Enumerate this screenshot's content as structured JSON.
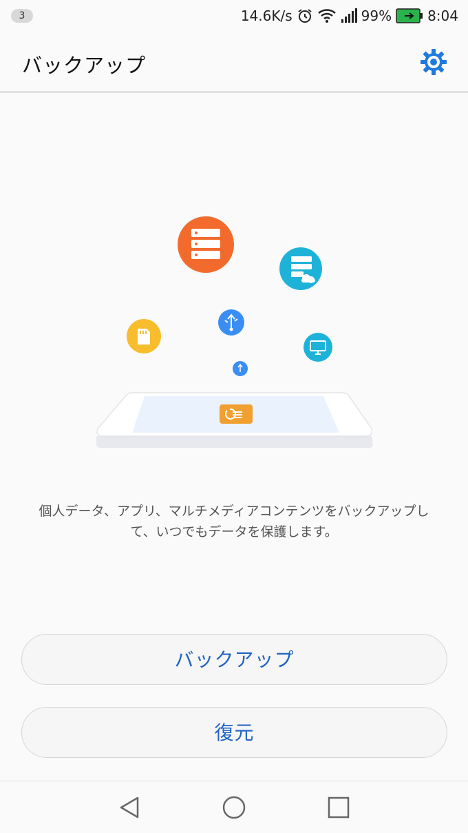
{
  "status_bar": {
    "notification_count": "3",
    "network_speed": "14.6K/s",
    "battery_percent": "99%",
    "time": "8:04",
    "icons": [
      "alarm-icon",
      "wifi-icon",
      "signal-icon",
      "battery-icon"
    ],
    "battery_color": "#2bb24c"
  },
  "app_bar": {
    "title": "バックアップ",
    "settings_icon": "gear-icon",
    "accent_color": "#1f7ae0"
  },
  "illustration": {
    "icons": [
      "server-icon",
      "cloud-server-icon",
      "usb-icon",
      "sd-card-icon",
      "monitor-icon",
      "usb-small-icon",
      "restore-list-icon"
    ],
    "colors": {
      "orange": "#f26b2d",
      "cyan": "#1fb2d9",
      "blue": "#3a8ef3",
      "yellow": "#f7bd2d",
      "phone_badge": "#f0a030"
    }
  },
  "description": "個人データ、アプリ、マルチメディアコンテンツをバックアップして、いつでもデータを保護します。",
  "buttons": {
    "backup_label": "バックアップ",
    "restore_label": "復元"
  },
  "nav_bar": {
    "icons": [
      "back-icon",
      "home-icon",
      "recents-icon"
    ]
  }
}
